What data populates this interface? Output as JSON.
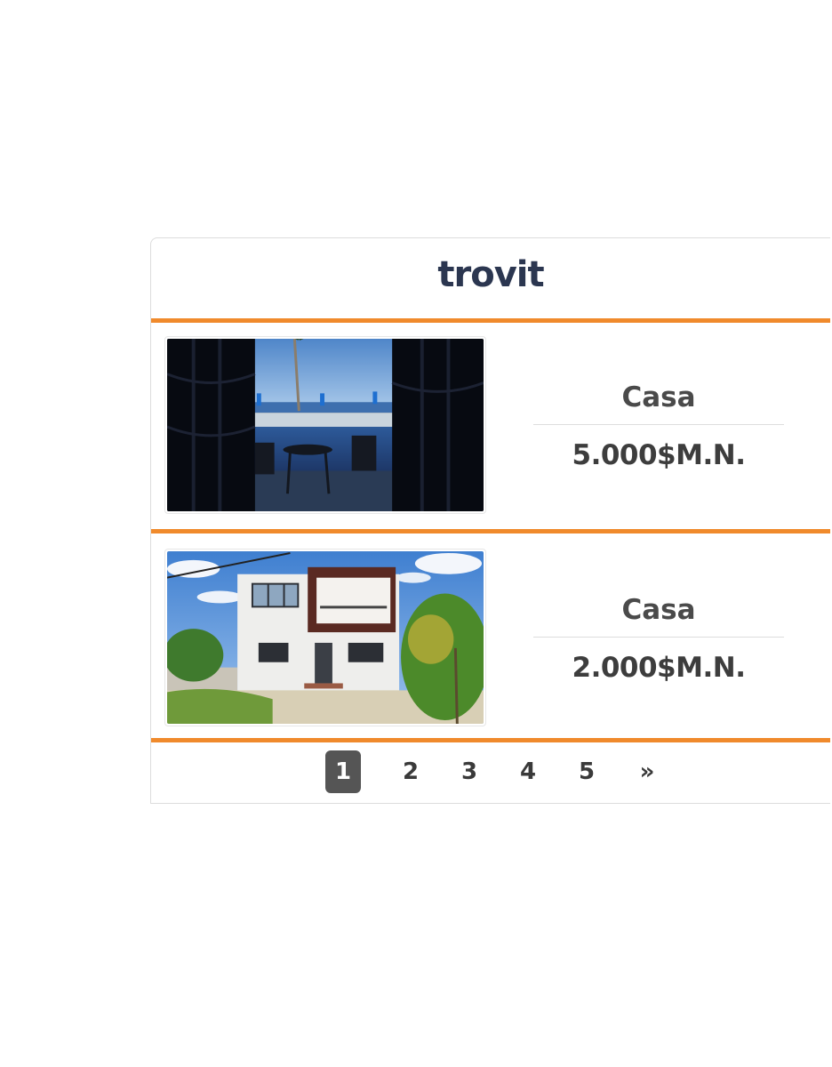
{
  "brand": {
    "logo_text": "trovit",
    "accent_color": "#f08a2c",
    "logo_color": "#2b3650"
  },
  "listings": [
    {
      "type": "Casa",
      "price": "5.000$M.N.",
      "photo": "pool-terrace-ocean-view"
    },
    {
      "type": "Casa",
      "price": "2.000$M.N.",
      "photo": "two-story-house-exterior"
    }
  ],
  "pagination": {
    "pages": [
      "1",
      "2",
      "3",
      "4",
      "5"
    ],
    "current": "1",
    "next_label": "»"
  }
}
